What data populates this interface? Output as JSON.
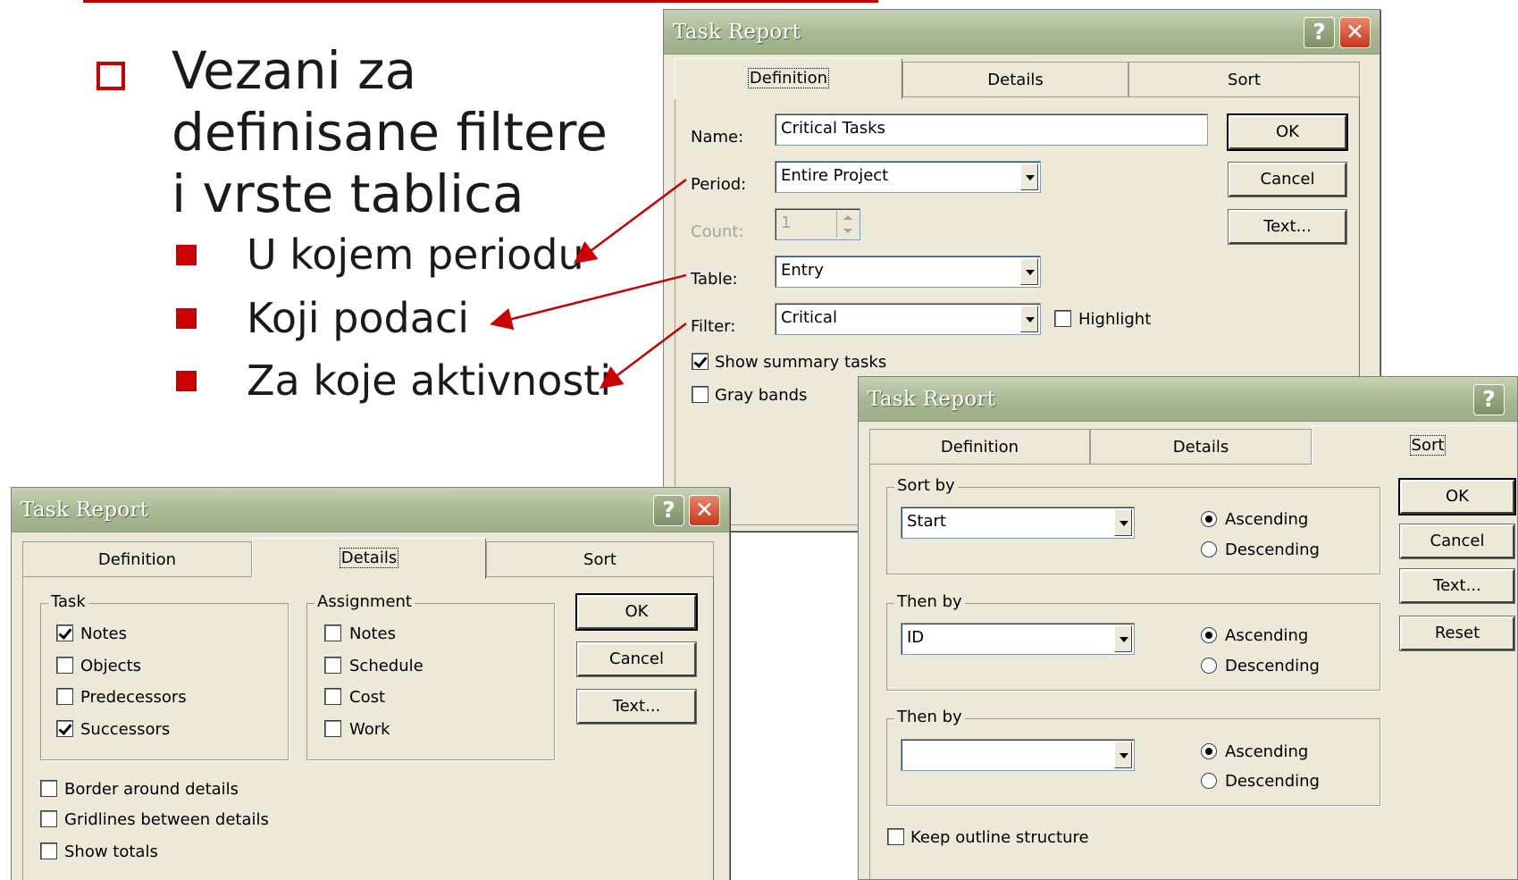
{
  "slide": {
    "bullet_main": "Vezani za definisane filtere i vrste tablica",
    "sub_bullets": [
      "U kojem periodu",
      "Koji podaci",
      "Za koje aktivnosti"
    ]
  },
  "dialog_definition": {
    "title": "Task Report",
    "tabs": [
      "Definition",
      "Details",
      "Sort"
    ],
    "name_label": "Name:",
    "name_value": "Critical Tasks",
    "period_label": "Period:",
    "period_value": "Entire Project",
    "count_label": "Count:",
    "count_value": "1",
    "table_label": "Table:",
    "table_value": "Entry",
    "filter_label": "Filter:",
    "filter_value": "Critical",
    "highlight_label": "Highlight",
    "show_summary_label": "Show summary tasks",
    "gray_bands_label": "Gray bands",
    "ok": "OK",
    "cancel": "Cancel",
    "text": "Text..."
  },
  "dialog_details": {
    "title": "Task Report",
    "tabs": [
      "Definition",
      "Details",
      "Sort"
    ],
    "task_group": "Task",
    "task_items": [
      "Notes",
      "Objects",
      "Predecessors",
      "Successors"
    ],
    "assignment_group": "Assignment",
    "assignment_items": [
      "Notes",
      "Schedule",
      "Cost",
      "Work"
    ],
    "border_label": "Border around details",
    "gridlines_label": "Gridlines between details",
    "show_totals_label": "Show totals",
    "ok": "OK",
    "cancel": "Cancel",
    "text": "Text..."
  },
  "dialog_sort": {
    "title": "Task Report",
    "tabs": [
      "Definition",
      "Details",
      "Sort"
    ],
    "sort_by_label": "Sort by",
    "sort_by_value": "Start",
    "then_by_label": "Then by",
    "then_by_value": "ID",
    "then_by2_label": "Then by",
    "then_by2_value": "",
    "ascending": "Ascending",
    "descending": "Descending",
    "keep_outline_label": "Keep outline structure",
    "ok": "OK",
    "cancel": "Cancel",
    "text": "Text...",
    "reset": "Reset"
  },
  "colors": {
    "accent": "#cc0000",
    "dialog_bg": "#ece9d8",
    "titlebar": "#a8b893"
  },
  "icons": [
    "help-icon",
    "close-icon",
    "dropdown-arrow-icon",
    "checkbox-icon",
    "radio-icon"
  ]
}
